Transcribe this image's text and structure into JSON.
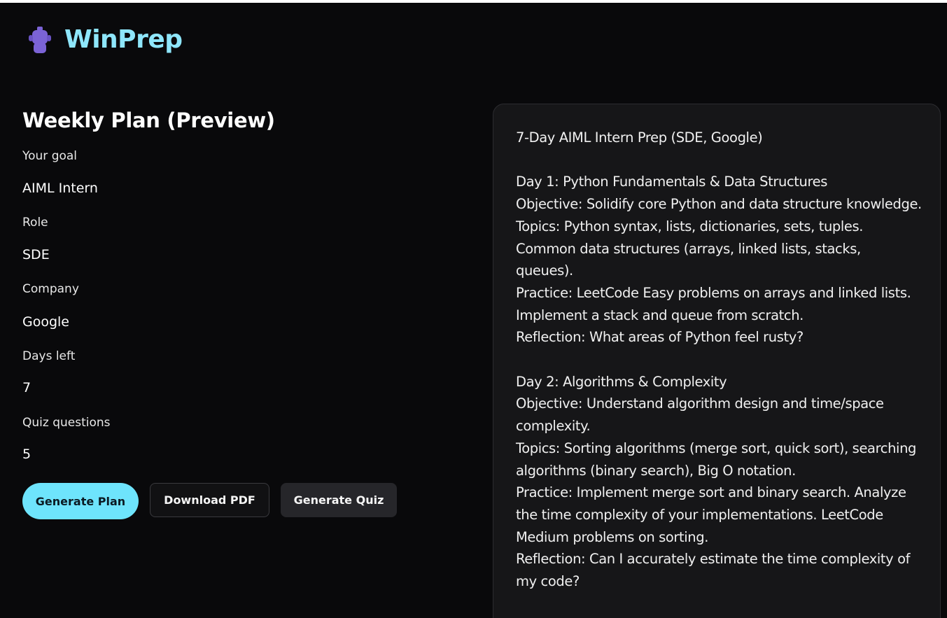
{
  "app": {
    "brand": "WinPrep",
    "logo_icon": "robot-mascot-icon",
    "colors": {
      "background": "#09090b",
      "brand": "#8ee6fb",
      "accent": "#6ee4fc",
      "panel": "#161618",
      "logo": "#7b63d6"
    }
  },
  "left": {
    "title": "Weekly Plan (Preview)",
    "fields": [
      {
        "label": "Your goal",
        "value": "AIML Intern"
      },
      {
        "label": "Role",
        "value": "SDE"
      },
      {
        "label": "Company",
        "value": "Google"
      },
      {
        "label": "Days left",
        "value": "7"
      },
      {
        "label": "Quiz questions",
        "value": "5"
      }
    ],
    "buttons": {
      "generate_plan": "Generate Plan",
      "download_pdf": "Download PDF",
      "generate_quiz": "Generate Quiz"
    }
  },
  "plan": {
    "text": "7-Day AIML Intern Prep (SDE, Google)\n\nDay 1: Python Fundamentals & Data Structures\nObjective: Solidify core Python and data structure knowledge.\nTopics: Python syntax, lists, dictionaries, sets, tuples. Common data structures (arrays, linked lists, stacks, queues).\nPractice: LeetCode Easy problems on arrays and linked lists. Implement a stack and queue from scratch.\nReflection: What areas of Python feel rusty?\n\nDay 2: Algorithms & Complexity\nObjective: Understand algorithm design and time/space complexity.\nTopics: Sorting algorithms (merge sort, quick sort), searching algorithms (binary search), Big O notation.\nPractice: Implement merge sort and binary search. Analyze the time complexity of your implementations. LeetCode Medium problems on sorting.\nReflection: Can I accurately estimate the time complexity of my code?"
  }
}
